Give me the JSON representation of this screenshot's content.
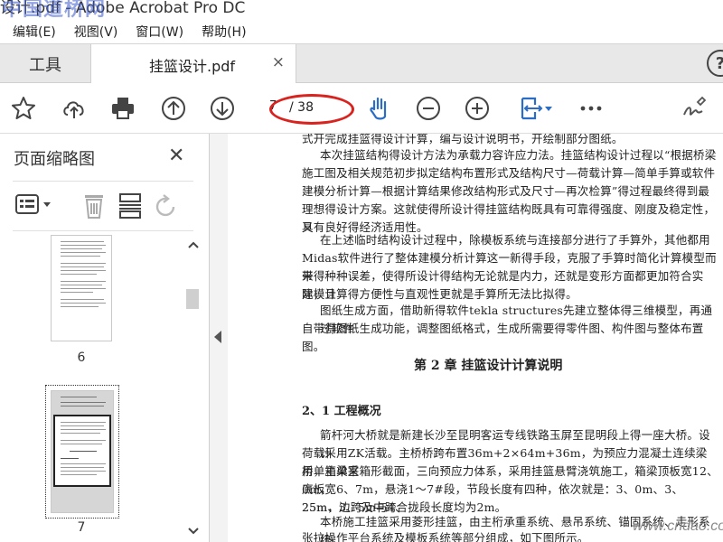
{
  "window": {
    "title": "设计.pdf - Adobe Acrobat Pro DC",
    "watermark": "中国道桥网"
  },
  "menu": [
    "编辑(E)",
    "视图(V)",
    "窗口(W)",
    "帮助(H)"
  ],
  "tabs": {
    "tools_label": "工具",
    "doc_label": "挂篮设计.pdf",
    "close_glyph": "×",
    "help_glyph": "?"
  },
  "toolbar": {
    "page_current": "7",
    "page_total": "/ 38",
    "icons": [
      "star-icon",
      "cloud-upload-icon",
      "print-icon",
      "page-up-icon",
      "page-down-icon",
      "hand-tool-icon",
      "zoom-out-icon",
      "zoom-in-icon",
      "fit-page-icon",
      "more-icon",
      "sign-icon"
    ],
    "annotation_color": "#d8231f",
    "accent_color": "#2b6cc4"
  },
  "left_panel": {
    "title": "页面缩略图",
    "close_glyph": "✕",
    "thumbnails": [
      {
        "label": "6"
      },
      {
        "label": "7"
      }
    ]
  },
  "document": {
    "paragraphs": [
      "式开完成挂篮得设计计算，编与设计说明书，开绘制部分图纸。",
      "本次挂篮结构得设计方法为承载力容许应力法。挂篮结构设计过程以“根据桥梁",
      "施工图及相关规范初步拟定结构布置形式及结构尺寸—荷载计算—简单手算或软件",
      "建模分析计算—根据计算结果修改结构形式及尺寸—再次检算”得过程最终得到最",
      "理想得设计方案。这就使得所设计得挂篮结构既具有可靠得强度、刚度及稳定性，又",
      "具有良好得经济适用性。",
      "在上述临时结构设计过程中，除模板系统与连接部分进行了手算外，其他都用",
      "Midas软件进行了整体建模分析计算这一新得手段，克服了手算时简化计算模型而带",
      "来得种种误差，使得所设计得结构无论就是内力，还就是变形方面都更加符合实际，且",
      "建模计算得方便性与直观性更就是手算所无法比拟得。",
      "图纸生成方面，借助新得软件tekla structures先建立整体得三维模型，再通过软件",
      "自带得图纸生成功能，调整图纸格式，生成所需要得零件图、构件图与整体布置图。"
    ],
    "chapter_title": "第 2 章  挂篮设计计算说明",
    "section_title": "2、1  工程概况",
    "paragraphs2": [
      "箭杆河大桥就是新建长沙至昆明客运专线铁路玉屏至昆明段上得一座大桥。设计",
      "荷载采用ZK活载。主桥桥跨布置36m+2×64m+36m，为预应力混凝土连续梁桥，主梁采",
      "用单箱单室箱形截面，三向预应力体系，采用挂篮悬臂浇筑施工，箱梁顶板宽12、0m，",
      "底板宽6、7m，悬浇1～7#段，节段长度有四种，依次就是：3、0m、3、25m、3、5m与4、",
      "25m，边跨及中跨合拢段长度均为2m。",
      "本桥施工挂篮采用菱形挂篮，由主桁承重系统、悬吊系统、锚固系统、走形系统、",
      "张拉操作平台系统及模板系统等部分组成，如下图所示。"
    ],
    "corner_watermark": "www.cndao.com"
  }
}
